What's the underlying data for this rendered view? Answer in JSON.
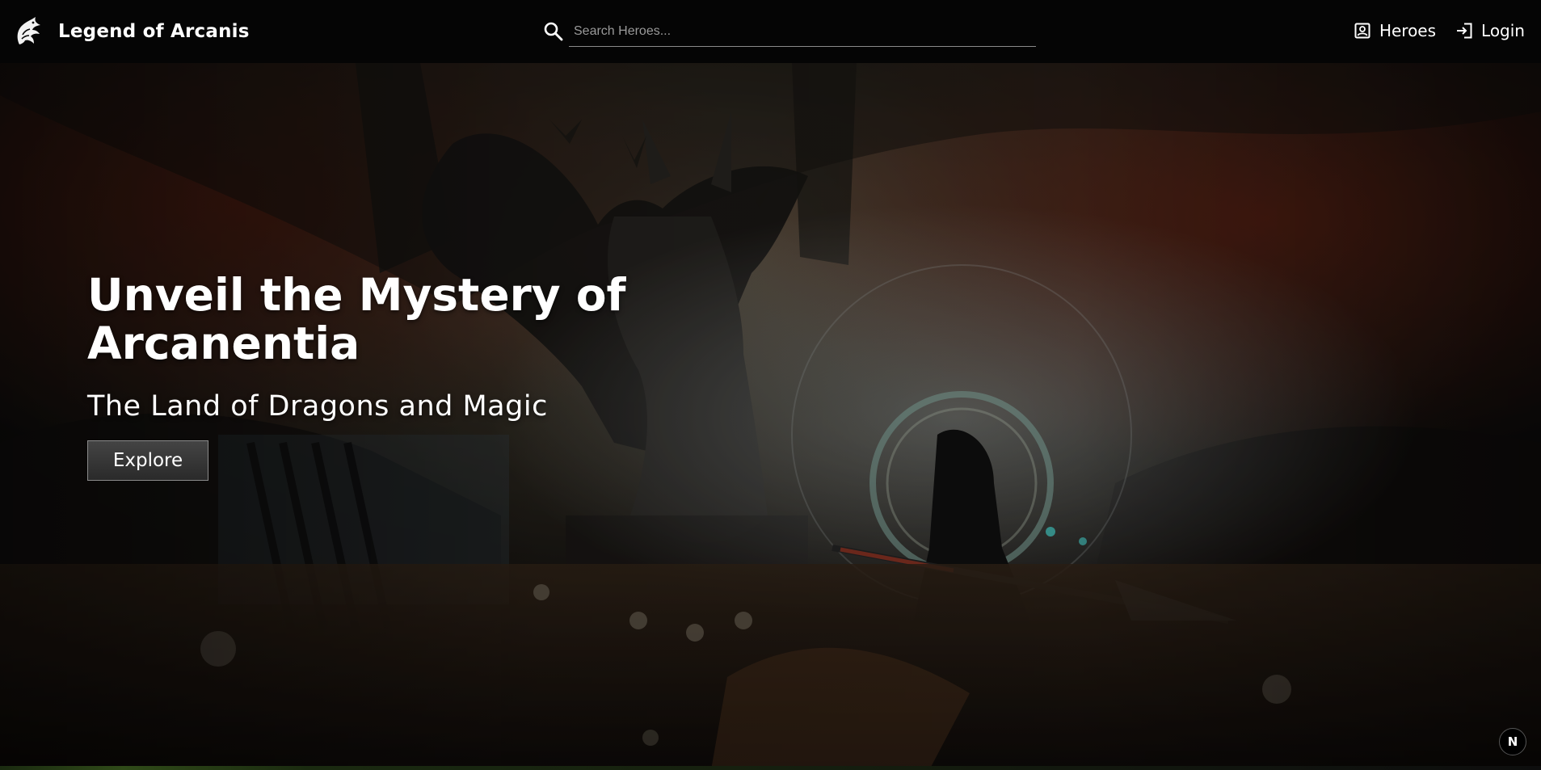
{
  "navbar": {
    "brand": {
      "title": "Legend of Arcanis",
      "logo_icon": "dragon-logo-icon"
    },
    "search": {
      "placeholder": "Search Heroes...",
      "value": "",
      "icon": "search-icon"
    },
    "links": [
      {
        "label": "Heroes",
        "icon": "user-card-icon"
      },
      {
        "label": "Login",
        "icon": "login-icon"
      }
    ]
  },
  "hero": {
    "title": "Unveil the Mystery of Arcanentia",
    "subtitle": "The Land of Dragons and Magic",
    "cta_label": "Explore",
    "background": "dragon-battle-artwork"
  },
  "badge": {
    "label": "N"
  },
  "colors": {
    "navbar_bg": "#050505",
    "text": "#ffffff",
    "button_bg": "#333333",
    "button_border": "#8a8a8a",
    "accent_fire": "#c0421c",
    "accent_rune": "#7fc9c0"
  }
}
